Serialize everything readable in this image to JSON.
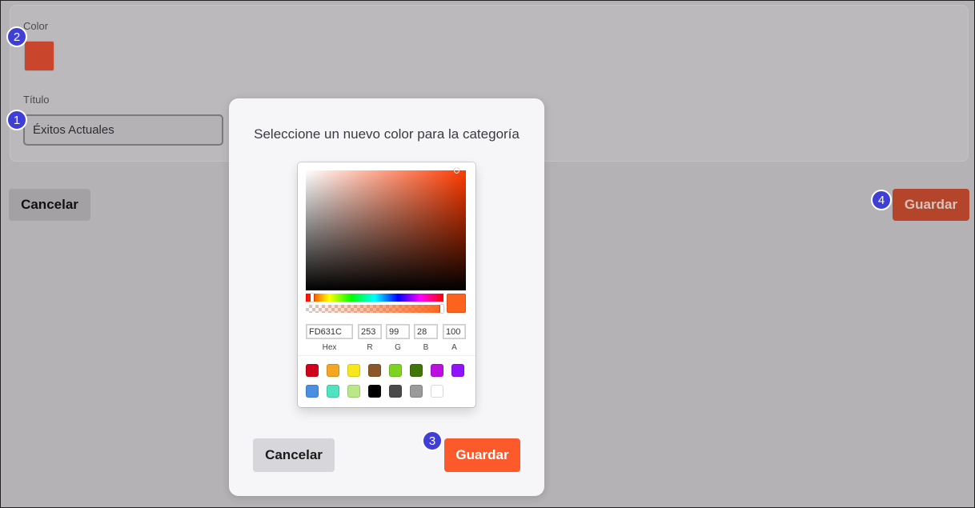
{
  "background": {
    "color_label": "Color",
    "color_value": "#c9452b",
    "title_label": "Título",
    "title_value": "Éxitos Actuales",
    "cancel_label": "Cancelar",
    "save_label": "Guardar"
  },
  "badges": [
    "1",
    "2",
    "3",
    "4"
  ],
  "modal": {
    "title": "Seleccione un nuevo color para la categoría",
    "cancel_label": "Cancelar",
    "save_label": "Guardar"
  },
  "picker": {
    "current_color": "#FD631C",
    "fields": {
      "hex": {
        "value": "FD631C",
        "label": "Hex"
      },
      "r": {
        "value": "253",
        "label": "R"
      },
      "g": {
        "value": "99",
        "label": "G"
      },
      "b": {
        "value": "28",
        "label": "B"
      },
      "a": {
        "value": "100",
        "label": "A"
      }
    },
    "presets": [
      "#D0021B",
      "#F5A623",
      "#F8E71C",
      "#8B572A",
      "#7ED321",
      "#417505",
      "#BD10E0",
      "#9013FE",
      "#4A90E2",
      "#50E3C2",
      "#B8E986",
      "#000000",
      "#4A4A4A",
      "#9B9B9B",
      "#FFFFFF"
    ]
  }
}
